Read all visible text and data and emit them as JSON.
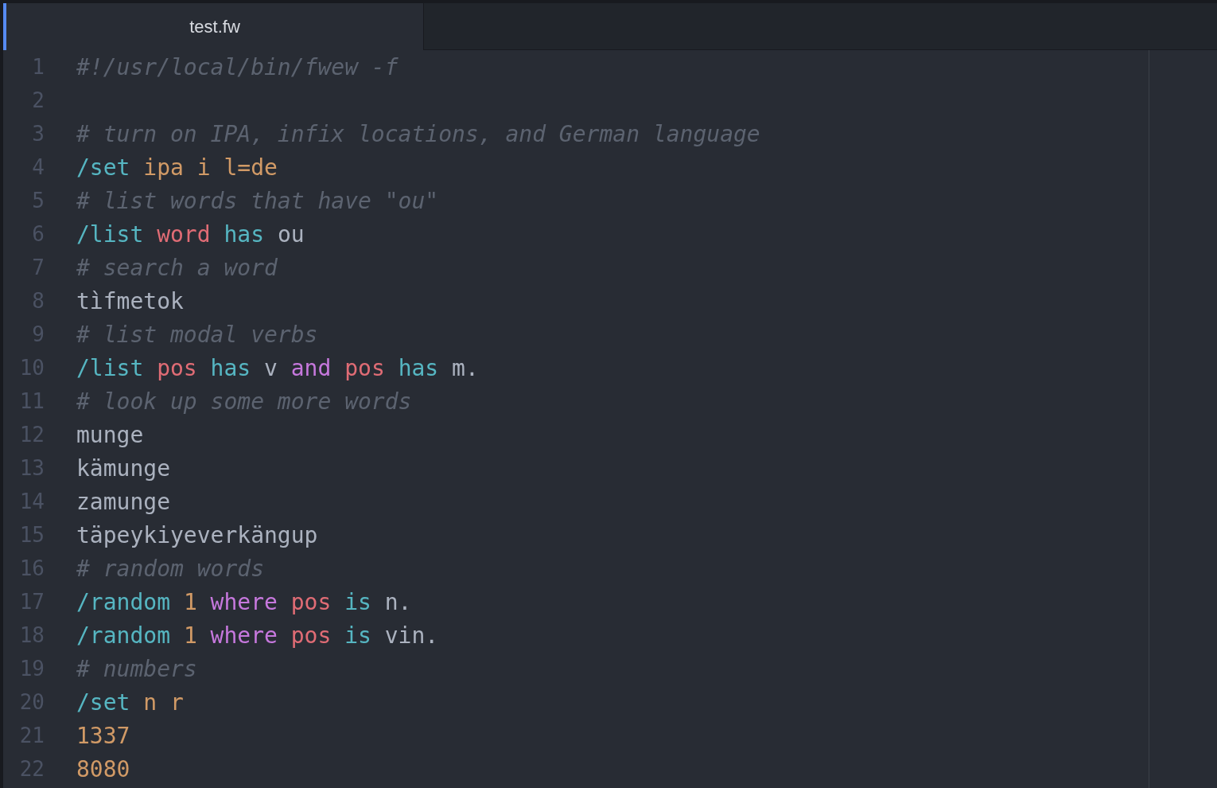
{
  "tabs": [
    {
      "label": "test.fw",
      "selected": true
    }
  ],
  "lines": [
    {
      "number": "1",
      "tokens": [
        {
          "text": "#!/usr/local/bin/fwew -f",
          "kind": "comment"
        }
      ]
    },
    {
      "number": "2"
    },
    {
      "number": "3",
      "tokens": [
        {
          "text": "# turn on IPA, infix locations, and German language",
          "kind": "comment"
        }
      ]
    },
    {
      "number": "4",
      "tokens": [
        {
          "text": "/set",
          "kind": "command"
        },
        {
          "text": "ipa i l=de",
          "kind": "argument"
        }
      ]
    },
    {
      "number": "5",
      "tokens": [
        {
          "text": "# list words that have \"ou\"",
          "kind": "comment"
        }
      ]
    },
    {
      "number": "6",
      "tokens": [
        {
          "text": "/list",
          "kind": "command"
        },
        {
          "text": "word",
          "kind": "field"
        },
        {
          "text": "has",
          "kind": "operator"
        },
        {
          "text": "ou",
          "kind": "plain"
        }
      ]
    },
    {
      "number": "7",
      "tokens": [
        {
          "text": "# search a word",
          "kind": "comment"
        }
      ]
    },
    {
      "number": "8",
      "tokens": [
        {
          "text": "tìfmetok",
          "kind": "plain"
        }
      ]
    },
    {
      "number": "9",
      "tokens": [
        {
          "text": "# list modal verbs",
          "kind": "comment"
        }
      ]
    },
    {
      "number": "10",
      "tokens": [
        {
          "text": "/list",
          "kind": "command"
        },
        {
          "text": "pos",
          "kind": "field"
        },
        {
          "text": "has",
          "kind": "operator"
        },
        {
          "text": "v",
          "kind": "plain"
        },
        {
          "text": "and",
          "kind": "conjunction"
        },
        {
          "text": "pos",
          "kind": "field"
        },
        {
          "text": "has",
          "kind": "operator"
        },
        {
          "text": "m.",
          "kind": "plain"
        }
      ]
    },
    {
      "number": "11",
      "tokens": [
        {
          "text": "# look up some more words",
          "kind": "comment"
        }
      ]
    },
    {
      "number": "12",
      "tokens": [
        {
          "text": "munge",
          "kind": "plain"
        }
      ]
    },
    {
      "number": "13",
      "tokens": [
        {
          "text": "kämunge",
          "kind": "plain"
        }
      ]
    },
    {
      "number": "14",
      "tokens": [
        {
          "text": "zamunge",
          "kind": "plain"
        }
      ]
    },
    {
      "number": "15",
      "tokens": [
        {
          "text": "täpeykiyeverkängup",
          "kind": "plain"
        }
      ]
    },
    {
      "number": "16",
      "tokens": [
        {
          "text": "# random words",
          "kind": "comment"
        }
      ]
    },
    {
      "number": "17",
      "tokens": [
        {
          "text": "/random",
          "kind": "command"
        },
        {
          "text": "1",
          "kind": "argument"
        },
        {
          "text": "where",
          "kind": "conjunction"
        },
        {
          "text": "pos",
          "kind": "field"
        },
        {
          "text": "is",
          "kind": "operator"
        },
        {
          "text": "n.",
          "kind": "plain"
        }
      ]
    },
    {
      "number": "18",
      "tokens": [
        {
          "text": "/random",
          "kind": "command"
        },
        {
          "text": "1",
          "kind": "argument"
        },
        {
          "text": "where",
          "kind": "conjunction"
        },
        {
          "text": "pos",
          "kind": "field"
        },
        {
          "text": "is",
          "kind": "operator"
        },
        {
          "text": "vin.",
          "kind": "plain"
        }
      ]
    },
    {
      "number": "19",
      "tokens": [
        {
          "text": "# numbers",
          "kind": "comment"
        }
      ]
    },
    {
      "number": "20",
      "tokens": [
        {
          "text": "/set",
          "kind": "command"
        },
        {
          "text": "n r",
          "kind": "argument"
        }
      ]
    },
    {
      "number": "21",
      "tokens": [
        {
          "text": "1337",
          "kind": "argument"
        }
      ]
    },
    {
      "number": "22",
      "tokens": [
        {
          "text": "8080",
          "kind": "argument"
        }
      ]
    }
  ]
}
